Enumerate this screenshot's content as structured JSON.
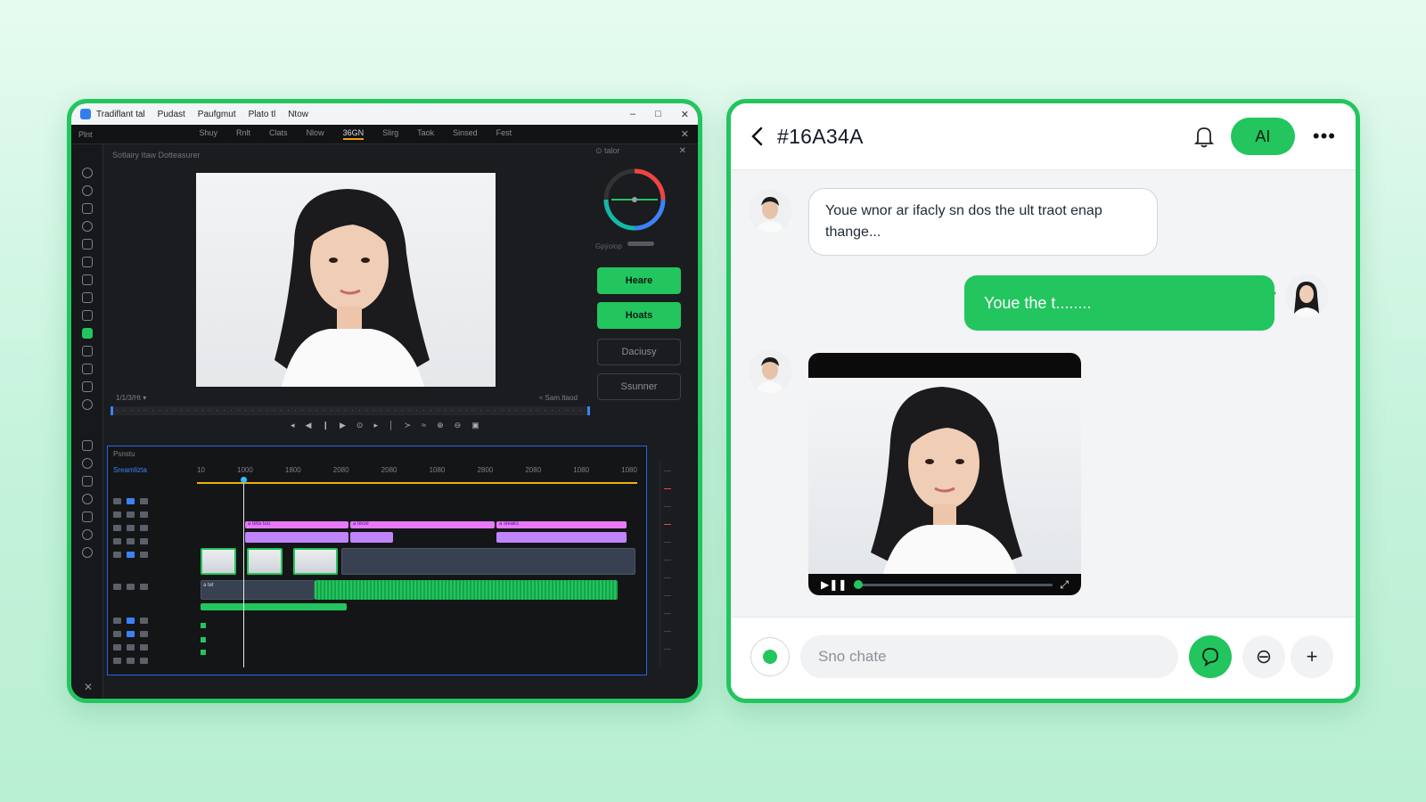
{
  "editor": {
    "titlebar": {
      "menu": [
        "Tradiflаnt tal",
        "Pudast",
        "Paufgmut",
        "Plato tl",
        "Ntow"
      ],
      "win_min": "–",
      "win_max": "□",
      "win_close": "✕"
    },
    "menubar": {
      "left": "Plnt",
      "tabs": [
        "Shuy",
        "Rnlt",
        "Clats",
        "Nlow",
        "36GN",
        "Slirg",
        "Taok",
        "Sinsed",
        "Fest"
      ],
      "active_tab_index": 4,
      "close": "✕"
    },
    "preview_label": "Sotlairy  Itaw  Dotteasurer",
    "timecode_left": "1/1/3/Ht ▾",
    "timecode_right": "≈  Sam.Itaod",
    "right_panel": {
      "title": "⊙  talor",
      "close": "✕",
      "wheel_label": "Gpýoiop",
      "buttons": [
        {
          "label": "Heare",
          "style": "primary"
        },
        {
          "label": "Hoats",
          "style": "primary"
        },
        {
          "label": "Daciusy",
          "style": "ghost"
        },
        {
          "label": "Ssunner",
          "style": "ghost"
        }
      ]
    },
    "transport": [
      "◂",
      "◀",
      "❙",
      "▶",
      "⊙",
      "▸",
      "│",
      "≻",
      "≈",
      "⊕",
      "⊖",
      "▣"
    ],
    "timeline": {
      "header": "Psnstu",
      "sequence_name": "Sreamlizta",
      "ruler": [
        "10",
        "1000",
        "1800",
        "2080",
        "2080",
        "1080",
        "2800",
        "2080",
        "1080",
        "1080"
      ],
      "clip_labels": [
        "a teta tuu",
        "a  tecie",
        "a sleaks"
      ],
      "audio_label": "a tet",
      "close": "✕"
    }
  },
  "chat": {
    "title": "#16A34A",
    "ai_label": "AI",
    "more": "•••",
    "messages": [
      {
        "from": "other",
        "text": "Youe wnor ar ifacly sn dos the ult traot enap thange..."
      },
      {
        "from": "me",
        "text": "Youe the t........"
      }
    ],
    "input_placeholder": "Sno chate",
    "buttons": {
      "minus": "⊖",
      "plus": "+"
    }
  },
  "colors": {
    "accent": "#22c55e",
    "page_bg": "#d7f7e6",
    "editor_bg": "#1a1c1f",
    "chat_bg": "#f3f4f6"
  }
}
